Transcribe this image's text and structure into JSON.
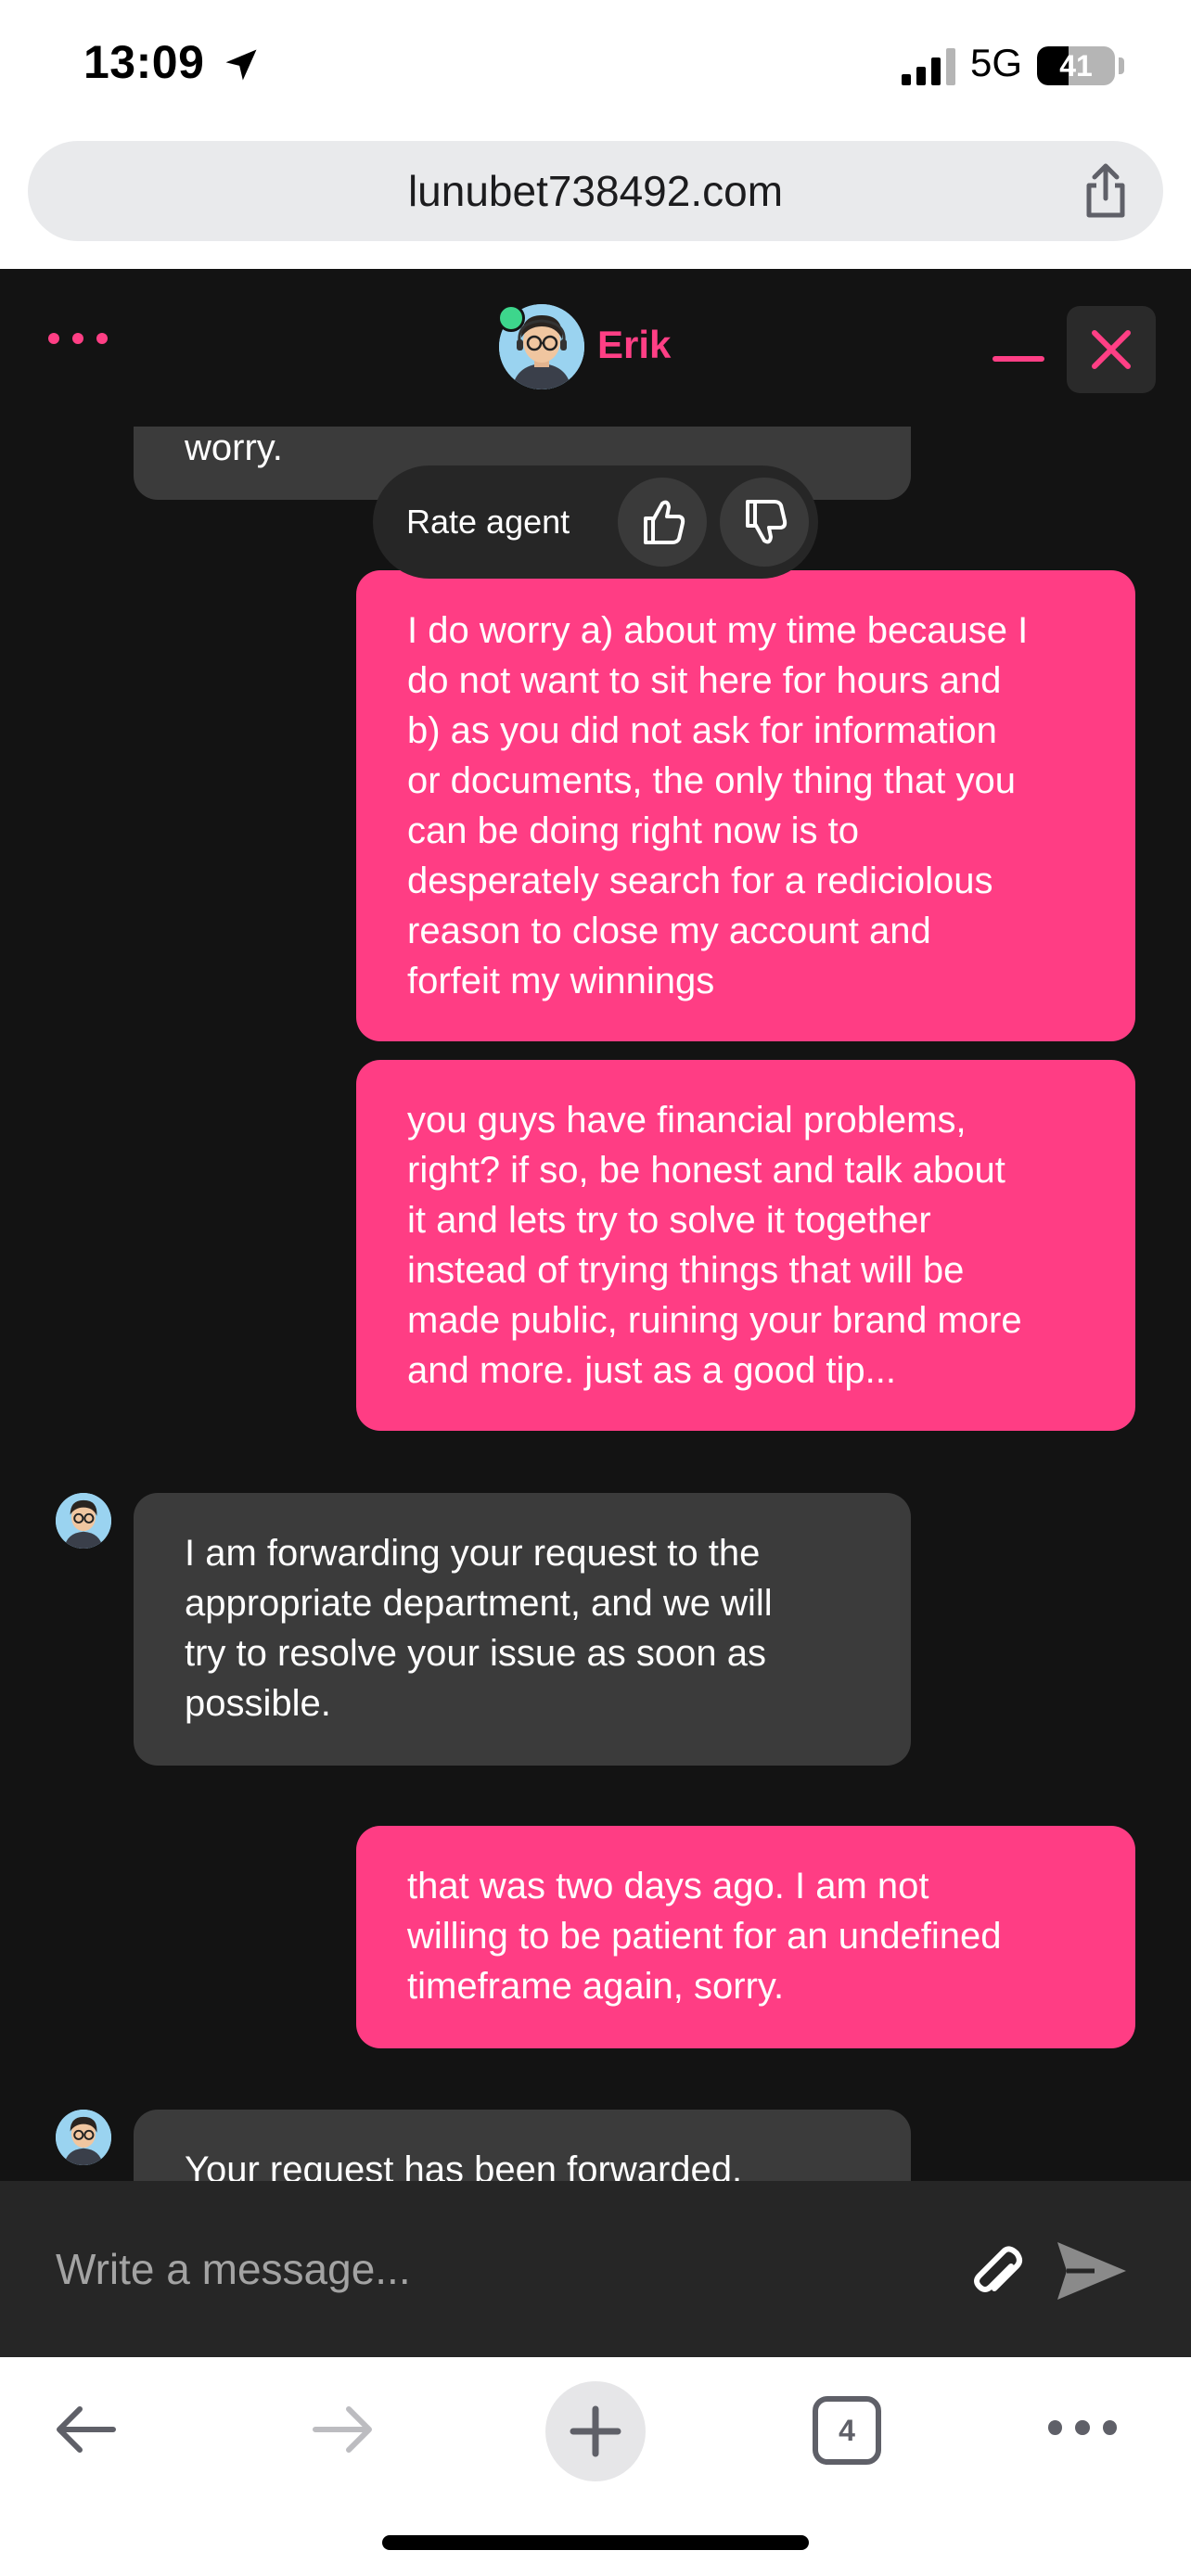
{
  "status_bar": {
    "time": "13:09",
    "network": "5G",
    "battery_level": "41",
    "battery_fraction": 0.41
  },
  "browser": {
    "url": "lunubet738492.com",
    "open_tab_count": "4"
  },
  "chat": {
    "agent_name": "Erik",
    "agent_online": true,
    "accent_color": "#ff3f85",
    "rate_label": "Rate agent",
    "messages": [
      {
        "from": "agent",
        "lines": [
          "worry."
        ]
      },
      {
        "from": "user",
        "lines": [
          "I do worry a) about my time because I",
          "do not want to sit here for hours and",
          "b) as you did not ask for information",
          "or documents, the only thing that you",
          "can be doing right now is to",
          "desperately search for a rediciolous",
          "reason to close my account and",
          "forfeit my winnings"
        ]
      },
      {
        "from": "user",
        "lines": [
          "you guys have financial problems,",
          "right? if so, be honest and talk about",
          "it and lets try to solve it together",
          "instead of trying things that will be",
          "made public, ruining your brand more",
          "and more. just as a good tip..."
        ]
      },
      {
        "from": "agent",
        "lines": [
          "I am forwarding your request to the",
          "appropriate department, and we will",
          "try to resolve your issue as soon as",
          "possible."
        ]
      },
      {
        "from": "user",
        "lines": [
          "that was two days ago. I am not",
          "willing to be patient for an undefined",
          "timeframe again, sorry."
        ]
      },
      {
        "from": "agent",
        "lines": [
          "Your request has been forwarded."
        ]
      }
    ],
    "composer_placeholder": "Write a message..."
  },
  "icons": {
    "location": "location-arrow-icon",
    "share": "share-icon",
    "menu": "more-dots-icon",
    "close": "close-icon",
    "minimize": "minimize-icon",
    "thumbs_up": "thumbs-up-icon",
    "thumbs_down": "thumbs-down-icon",
    "attach": "paperclip-icon",
    "send": "send-icon",
    "back": "back-arrow-icon",
    "forward": "forward-arrow-icon",
    "new_tab": "plus-icon",
    "tabs": "tabs-icon",
    "more": "more-dots-icon"
  }
}
